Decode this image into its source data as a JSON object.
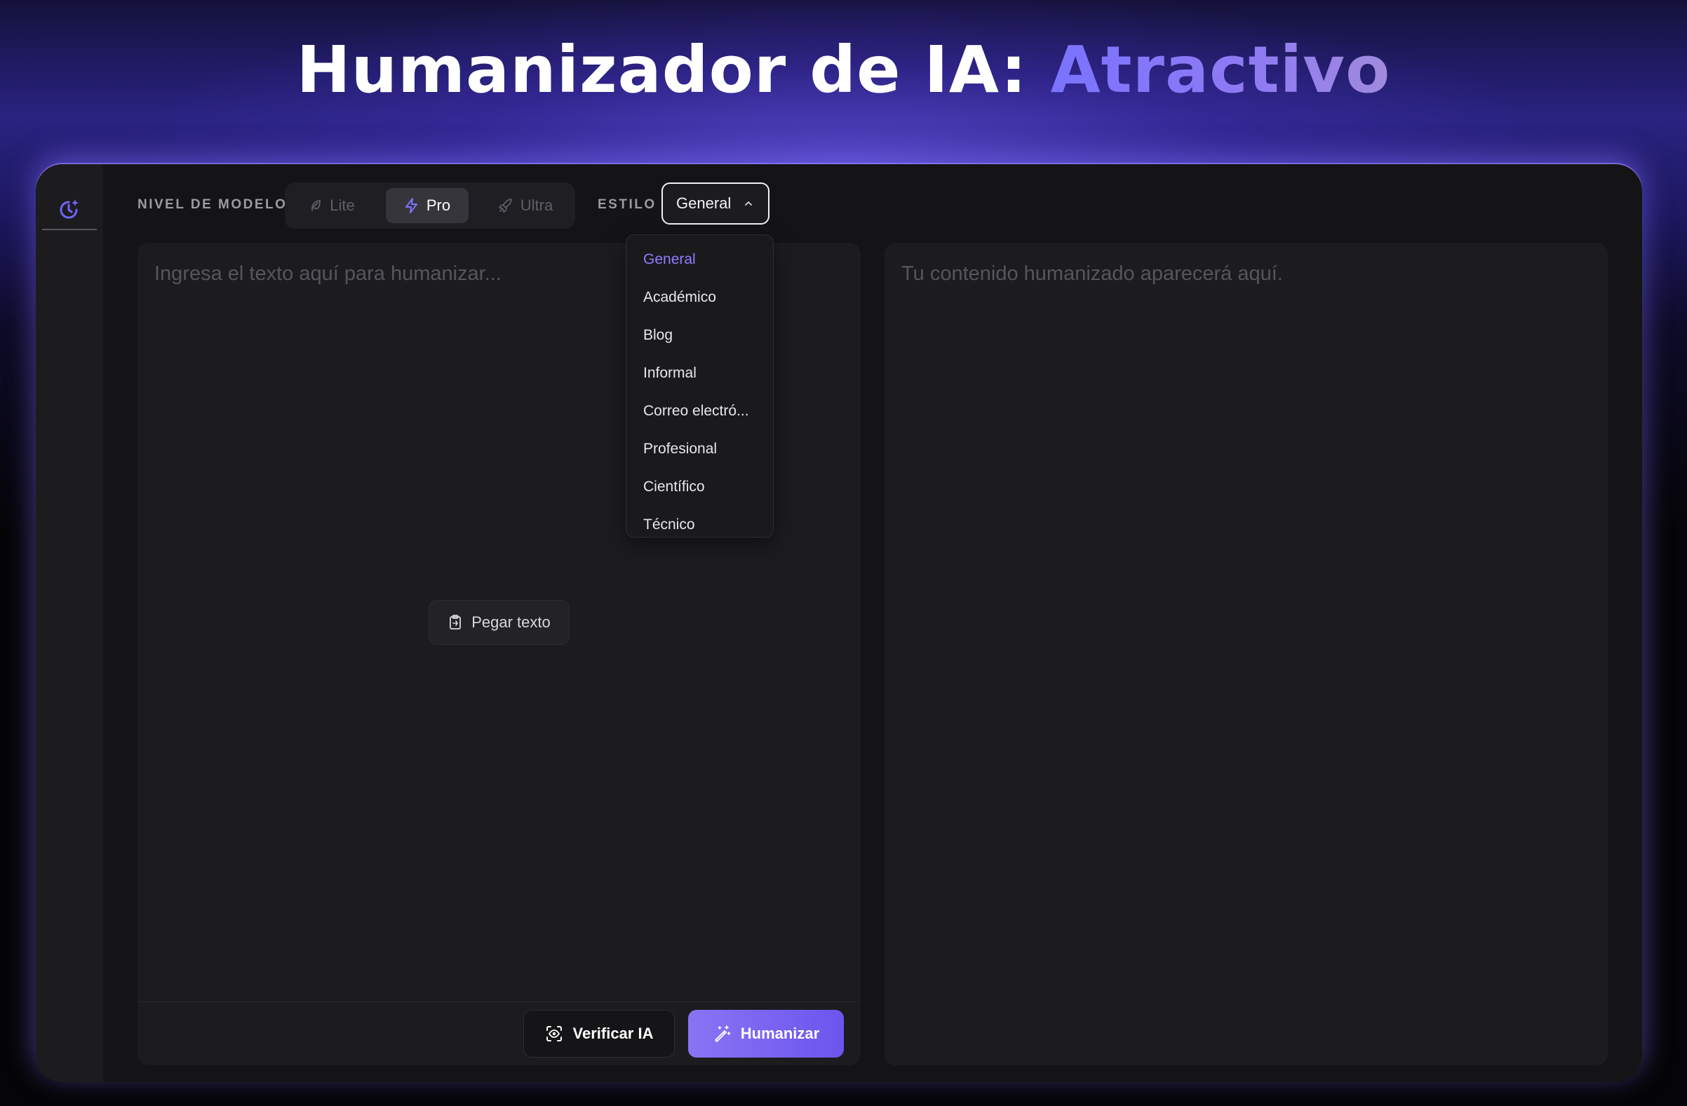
{
  "hero": {
    "title_prefix": "Humanizador de IA:",
    "title_accent": "Atractivo"
  },
  "sidebar": {
    "history_icon": "history-sparkle-icon"
  },
  "toolbar": {
    "model_level_label": "NIVEL DE MODELO",
    "model_options": [
      {
        "label": "Lite",
        "icon": "feather-icon",
        "active": false
      },
      {
        "label": "Pro",
        "icon": "lightning-icon",
        "active": true
      },
      {
        "label": "Ultra",
        "icon": "rocket-icon",
        "active": false
      }
    ],
    "style_label": "ESTILO",
    "style_selected": "General",
    "style_chevron": "chevron-up-icon"
  },
  "style_dropdown": {
    "options": [
      "General",
      "Académico",
      "Blog",
      "Informal",
      "Correo electró...",
      "Profesional",
      "Científico",
      "Técnico"
    ],
    "selected_index": 0
  },
  "editor": {
    "placeholder": "Ingresa el texto aquí para humanizar...",
    "paste_label": "Pegar texto",
    "verify_label": "Verificar IA",
    "humanize_label": "Humanizar"
  },
  "output": {
    "placeholder": "Tu contenido humanizado aparecerá aquí."
  },
  "colors": {
    "accent": "#8a74f4",
    "accent_dark": "#6b55ee",
    "panel_bg": "#141416",
    "card_bg": "#1c1c1f",
    "selected_text": "#8f7bff"
  }
}
